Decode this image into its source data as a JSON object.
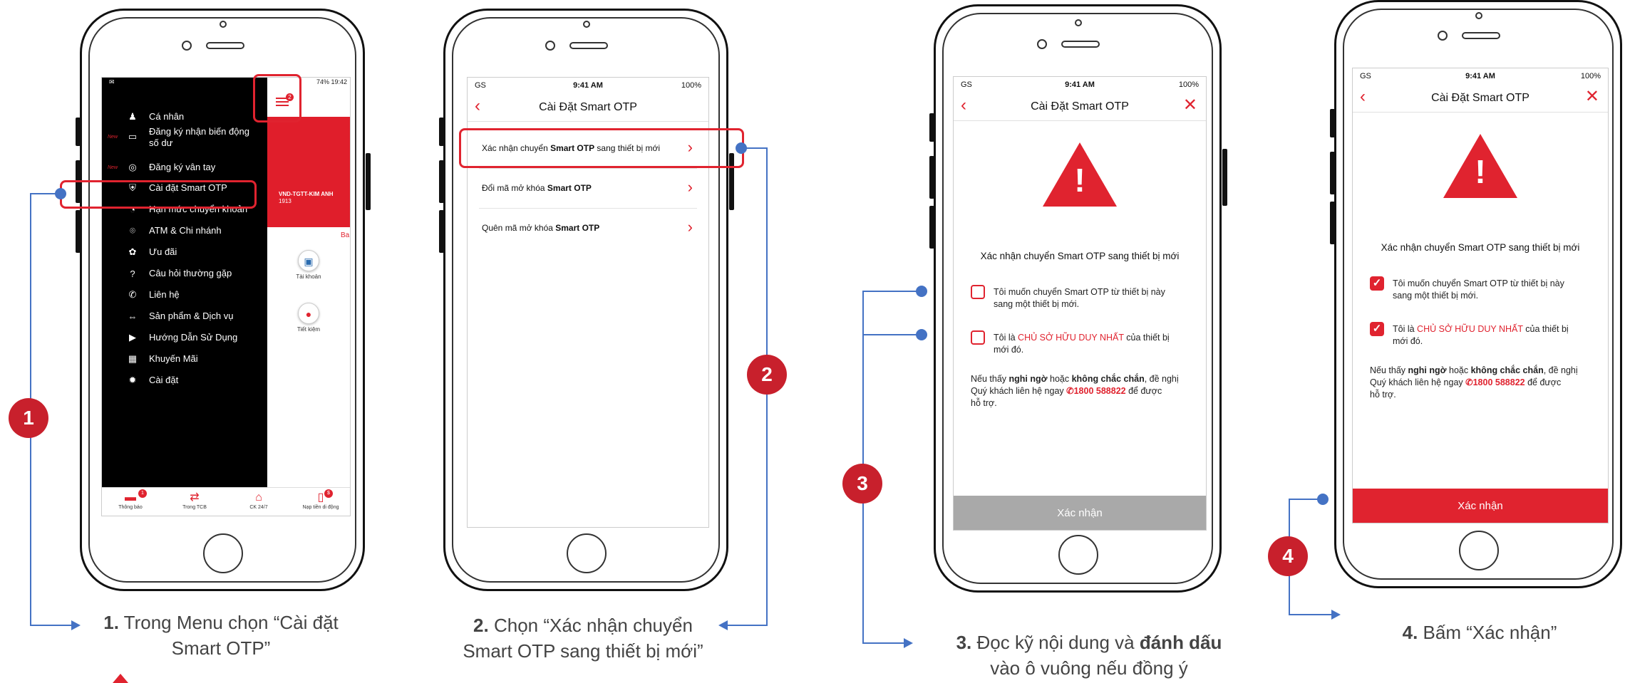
{
  "steps": {
    "s1": {
      "num": "1",
      "caption_bold": "1.",
      "caption_l1": " Trong Menu chọn “Cài đặt",
      "caption_l2": "Smart OTP”"
    },
    "s2": {
      "num": "2",
      "caption_bold": "2.",
      "caption_l1": " Chọn “Xác nhận chuyển",
      "caption_l2": "Smart OTP sang thiết bị mới”"
    },
    "s3": {
      "num": "3",
      "caption_bold": "3.",
      "caption_mid": " Đọc kỹ nội dung và ",
      "caption_bold2": "đánh dấu",
      "caption_l2": "vào ô vuông nếu đồng ý"
    },
    "s4": {
      "num": "4",
      "caption_bold": "4.",
      "caption_l1": " Bấm “Xác nhận”"
    }
  },
  "phone1": {
    "status_time": "19:42",
    "status_batt": "74%",
    "menu_badge": "2",
    "menu": [
      {
        "label": "Cá nhân",
        "icon": "person-icon",
        "new": ""
      },
      {
        "label": "Đăng ký nhận biến động",
        "label2": "số dư",
        "icon": "card-icon",
        "new": "New"
      },
      {
        "label": "Đăng ký vân tay",
        "icon": "fingerprint-icon",
        "new": "New"
      },
      {
        "label": "Cài đặt Smart OTP",
        "icon": "shield-icon",
        "new": ""
      },
      {
        "label": "Hạn mức chuyển khoản",
        "icon": "gauge-icon",
        "new": ""
      },
      {
        "label": "ATM & Chi nhánh",
        "icon": "location-icon",
        "new": ""
      },
      {
        "label": "Ưu đãi",
        "icon": "gift-icon",
        "new": ""
      },
      {
        "label": "Câu hỏi thường gặp",
        "icon": "question-icon",
        "new": ""
      },
      {
        "label": "Liên hệ",
        "icon": "phone-icon",
        "new": ""
      },
      {
        "label": "Sản phẩm & Dịch vụ",
        "icon": "arrows-icon",
        "new": ""
      },
      {
        "label": "Hướng Dẫn Sử Dụng",
        "icon": "play-icon",
        "new": ""
      },
      {
        "label": "Khuyến Mãi",
        "icon": "present-icon",
        "new": ""
      },
      {
        "label": "Cài đặt",
        "icon": "gear-icon",
        "new": ""
      }
    ],
    "account_name": "VND-TGTT-KIM ANH",
    "account_no": "1913",
    "account_link": "Ba",
    "quick": [
      {
        "label": "Tài khoản",
        "icon": "wallet-icon"
      },
      {
        "label": "Tiết kiệm",
        "icon": "piggy-icon"
      }
    ],
    "tabs": [
      {
        "label": "Thông báo",
        "icon": "chat-icon",
        "badge": "1"
      },
      {
        "label": "Trong TCB",
        "icon": "transfer-icon",
        "badge": ""
      },
      {
        "label": "CK 24/7",
        "icon": "bank-icon",
        "badge": ""
      },
      {
        "label": "Nạp tiền di động",
        "icon": "topup-icon",
        "badge": "$"
      }
    ]
  },
  "ios_status": {
    "carrier": "GS",
    "time": "9:41 AM",
    "battery": "100%"
  },
  "phone2": {
    "title": "Cài Đặt Smart OTP",
    "rows": [
      {
        "pre": "Xác nhận chuyển ",
        "bold": "Smart OTP",
        "post": " sang thiết bị mới"
      },
      {
        "pre": "Đổi mã mở khóa ",
        "bold": "Smart OTP",
        "post": ""
      },
      {
        "pre": "Quên mã mở khóa ",
        "bold": "Smart OTP",
        "post": ""
      }
    ]
  },
  "confirm": {
    "title": "Cài Đặt Smart OTP",
    "heading": "Xác nhận chuyển Smart OTP sang thiết bị mới",
    "cb1_l1": "Tôi muốn chuyển Smart OTP từ thiết bị này",
    "cb1_l2": "sang một thiết bị mới.",
    "cb2_pre": "Tôi là ",
    "cb2_red": "CHỦ SỞ HỮU DUY NHẤT",
    "cb2_post": " của thiết bị",
    "cb2_l2": "mới đó.",
    "note_pre": "Nếu thấy ",
    "note_b1": "nghi ngờ",
    "note_mid": " hoặc ",
    "note_b2": "không chắc chắn",
    "note_post": ", đề nghị",
    "note_l2_pre": "Quý khách liên hệ ngay ",
    "note_phone": "1800 588822",
    "note_l2_post": " để được",
    "note_l3": "hỗ trợ.",
    "button": "Xác nhận",
    "button_disabled_color": "#a9a9a9",
    "button_active_color": "#e0232f"
  },
  "colors": {
    "brand_red": "#e0232f",
    "connector_blue": "#4472c4",
    "step_red": "#c8202c"
  }
}
